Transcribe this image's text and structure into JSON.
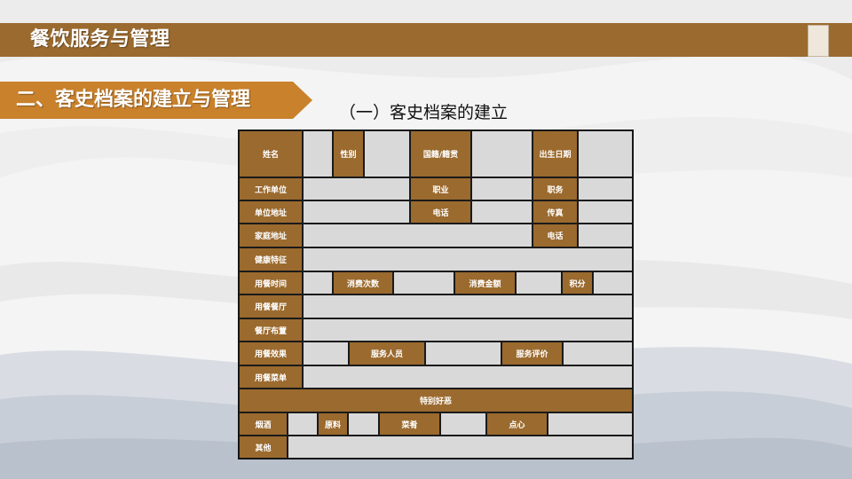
{
  "header": {
    "title": "餐饮服务与管理"
  },
  "section": {
    "title": "二、客史档案的建立与管理"
  },
  "subsection": {
    "title": "（一）客史档案的建立"
  },
  "form": {
    "name": "姓名",
    "gender": "性别",
    "nationality": "国籍/籍贯",
    "birth_date": "出生日期",
    "work_unit": "工作单位",
    "occupation": "职业",
    "position": "职务",
    "unit_address": "单位地址",
    "phone": "电话",
    "fax": "传真",
    "home_address": "家庭地址",
    "home_phone": "电话",
    "health": "健康特征",
    "dining_time": "用餐时间",
    "visit_count": "消费次数",
    "spend_amount": "消费金额",
    "points": "积分",
    "dining_hall": "用餐餐厅",
    "hall_layout": "餐厅布置",
    "dining_effect": "用餐效果",
    "service_staff": "服务人员",
    "service_rating": "服务评价",
    "dining_menu": "用餐菜单",
    "special_prefs": "特别好恶",
    "tobacco_alcohol": "烟酒",
    "ingredients": "原料",
    "dishes": "菜肴",
    "dessert": "点心",
    "other": "其他"
  },
  "colors": {
    "accent": "#9b6a2e",
    "banner": "#c9812c",
    "cell": "#d9d9d9"
  }
}
